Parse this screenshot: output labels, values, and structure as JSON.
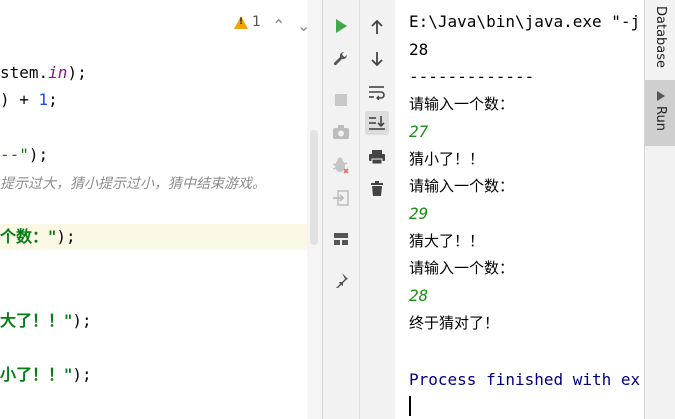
{
  "editor": {
    "warning_count": "1",
    "lines": {
      "l1_pre": "stem.",
      "l1_field": "in",
      "l1_post": ");",
      "l2_pre": ") + ",
      "l2_num": "1",
      "l2_post": ";",
      "l3_str": "--\"",
      "l3_post": ");",
      "l4_comment": "提示过大，猜小提示过小，猜中结束游戏。",
      "l5_str": "个数：\"",
      "l5_post": ");",
      "l6_str": "大了！！\"",
      "l6_post": ");",
      "l7_str": "小了！！\"",
      "l7_post": ");"
    }
  },
  "console": {
    "lines": [
      "E:\\Java\\bin\\java.exe \"-j",
      "28",
      "-------------",
      "请输入一个数：",
      "27",
      "猜小了！！",
      "请输入一个数：",
      "29",
      "猜大了！！",
      "请输入一个数：",
      "28",
      "终于猜对了！"
    ],
    "finished": "Process finished with ex"
  },
  "side": {
    "database_label": "Database",
    "run_label": "Run"
  },
  "icons": {
    "run": "play-icon",
    "settings": "wrench-icon",
    "stop": "stop-icon",
    "screenshot": "camera-icon",
    "debug": "bug-icon",
    "exit": "exit-icon",
    "layout": "layout-icon",
    "pin": "pin-icon",
    "up": "arrow-up-icon",
    "down": "arrow-down-icon",
    "wrap": "soft-wrap-icon",
    "scroll_end": "scroll-to-end-icon",
    "print": "print-icon",
    "delete": "trash-icon"
  },
  "colors": {
    "accent_green": "#3fa84a",
    "warning": "#f0a30a",
    "finished_text": "#000080"
  }
}
